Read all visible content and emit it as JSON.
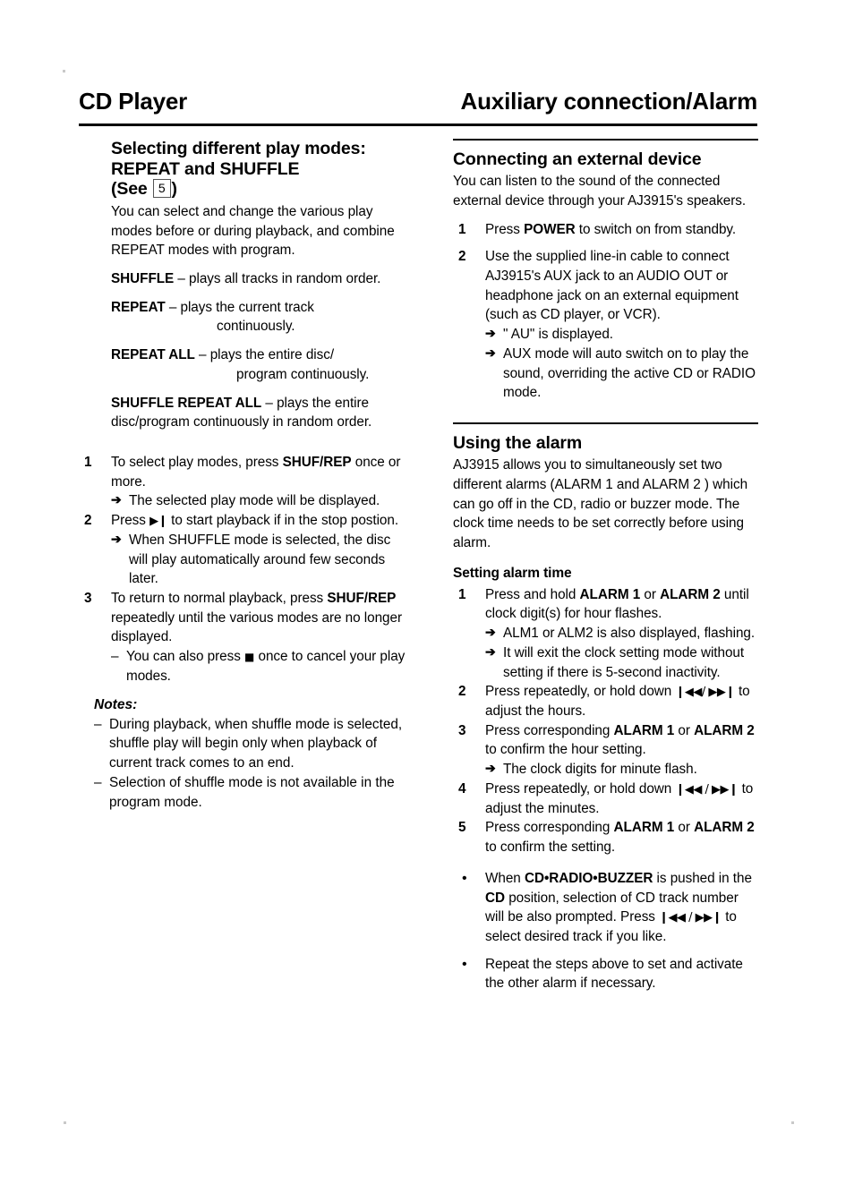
{
  "header": {
    "left_title": "CD Player",
    "right_title": "Auxiliary connection/Alarm"
  },
  "left_column": {
    "heading_line1": "Selecting different play modes:",
    "heading_line2": "REPEAT and SHUFFLE",
    "heading_line3_pre": "(See ",
    "heading_box_number": "5",
    "heading_line3_post": ")",
    "intro": "You can select and change the various play modes before or during playback, and combine REPEAT modes with program.",
    "definitions": [
      {
        "term": "SHUFFLE",
        "dash": " – ",
        "text": "plays all tracks in random order.",
        "continuation": ""
      },
      {
        "term": "REPEAT",
        "dash": " – ",
        "text": "plays the current track",
        "continuation": "continuously."
      },
      {
        "term": "REPEAT ALL",
        "dash": " – ",
        "text": "plays the entire disc/",
        "continuation": "program continuously."
      },
      {
        "term": "SHUFFLE REPEAT ALL",
        "dash": " – ",
        "text": "plays the entire disc/program continuously in random order.",
        "continuation": ""
      }
    ],
    "steps": [
      {
        "num": "1",
        "text_pre": "To select play modes, press ",
        "bold": "SHUF/REP",
        "text_post": " once or more.",
        "arrows": [
          "The selected play mode will be displayed."
        ]
      },
      {
        "num": "2",
        "text_pre": "Press ",
        "glyph": "▶❙",
        "text_post": " to start playback if in the stop postion.",
        "arrows": [
          "When SHUFFLE mode is selected, the disc will play automatically around few seconds later."
        ]
      },
      {
        "num": "3",
        "text_pre": "To return to normal playback, press ",
        "bold": "SHUF/REP",
        "text_post": " repeatedly until the various modes are no longer displayed.",
        "dashes_pre": "You can also press ",
        "dashes_glyph": "■",
        "dashes_post": " once to cancel your play modes."
      }
    ],
    "notes_heading": "Notes:",
    "notes": [
      "During playback, when shuffle mode is selected, shuffle play will begin only when playback of current track comes to an end.",
      "Selection of shuffle mode is not available in the program mode."
    ]
  },
  "right_column": {
    "section1": {
      "heading": "Connecting an external device",
      "intro": "You can listen to the sound of the connected external device through your AJ3915's speakers.",
      "steps": [
        {
          "num": "1",
          "text_pre": "Press ",
          "bold": "POWER",
          "text_post": " to switch on from standby."
        },
        {
          "num": "2",
          "text_pre": "Use the supplied line-in cable to connect AJ3915's AUX jack to an AUDIO OUT or headphone jack on an external equipment (such as CD player, or VCR).",
          "arrows": [
            "\" AU\" is displayed.",
            "AUX mode will auto switch on to play the sound, overriding the active CD or RADIO mode."
          ]
        }
      ]
    },
    "section2": {
      "heading": "Using the alarm",
      "intro": "AJ3915 allows you to simultaneously set two different alarms (ALARM 1 and ALARM 2 ) which can go off in the CD, radio or buzzer mode. The clock time needs to be set correctly before using alarm.",
      "sub_heading": "Setting alarm time",
      "steps": [
        {
          "num": "1",
          "text_pre": "Press and hold ",
          "bold1": "ALARM 1",
          "text_mid": " or ",
          "bold2": "ALARM 2",
          "text_post": " until clock digit(s) for hour flashes.",
          "arrows": [
            "ALM1 or ALM2 is also displayed, flashing.",
            "It will exit the clock setting mode without setting if there is 5-second inactivity."
          ]
        },
        {
          "num": "2",
          "text_pre": "Press repeatedly, or hold down ",
          "glyph": "❙◀◀/ ▶▶❙",
          "text_post": " to adjust the hours."
        },
        {
          "num": "3",
          "text_pre": "Press corresponding ",
          "bold1": "ALARM 1",
          "text_mid": " or ",
          "bold2": "ALARM 2",
          "text_post": " to confirm the hour setting.",
          "arrows": [
            "The clock digits for minute flash."
          ]
        },
        {
          "num": "4",
          "text_pre": "Press repeatedly, or hold down ",
          "glyph": "❙◀◀ / ▶▶❙",
          "text_post": " to adjust the minutes."
        },
        {
          "num": "5",
          "text_pre": "Press corresponding ",
          "bold1": "ALARM 1",
          "text_mid": " or ",
          "bold2": "ALARM 2",
          "text_post": " to confirm the setting."
        }
      ],
      "bullets": [
        {
          "marker": "•",
          "text_pre": "When ",
          "bold1": "CD•RADIO•BUZZER",
          "text_mid": " is pushed in the ",
          "bold2": "CD",
          "text_post": " position, selection of CD track number will be also prompted. Press ",
          "glyph": "❙◀◀ / ▶▶❙",
          "text_end": " to select desired track if you like."
        },
        {
          "marker": "•",
          "text_pre": "Repeat the steps above to set and activate the other alarm if necessary."
        }
      ]
    }
  }
}
